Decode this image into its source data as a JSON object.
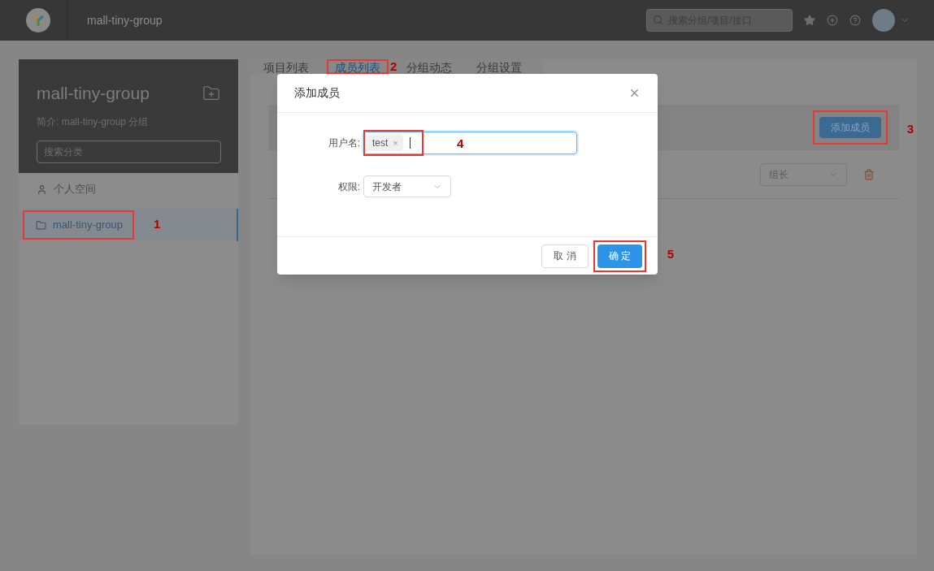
{
  "header": {
    "title": "mall-tiny-group",
    "search": {
      "placeholder": "搜索分组/项目/接口"
    }
  },
  "sidebar": {
    "title": "mall-tiny-group",
    "description": "简介: mall-tiny-group 分组",
    "search": {
      "placeholder": "搜索分类"
    },
    "items": [
      {
        "kind": "personal",
        "label": "个人空间",
        "selected": false
      },
      {
        "kind": "group",
        "label": "mall-tiny-group",
        "selected": true,
        "annotation": "1"
      }
    ]
  },
  "tabs": [
    {
      "label": "项目列表",
      "selected": false
    },
    {
      "label": "成员列表",
      "selected": true,
      "annotation": "2"
    },
    {
      "label": "分组动态",
      "selected": false
    },
    {
      "label": "分组设置",
      "selected": false
    }
  ],
  "members": {
    "add_button": {
      "label": "添加成员",
      "annotation": "3"
    },
    "rows": [
      {
        "role": "组长"
      }
    ]
  },
  "dialog": {
    "title": "添加成员",
    "fields": [
      {
        "kind": "tags",
        "label": "用户名:",
        "tags": [
          {
            "label": "test",
            "close": "×"
          }
        ],
        "annotation": "4"
      },
      {
        "kind": "select",
        "label": "权限:",
        "value": "开发者"
      }
    ],
    "buttons": [
      {
        "label": "取 消",
        "primary": false
      },
      {
        "label": "确 定",
        "primary": true,
        "annotation": "5"
      }
    ]
  }
}
